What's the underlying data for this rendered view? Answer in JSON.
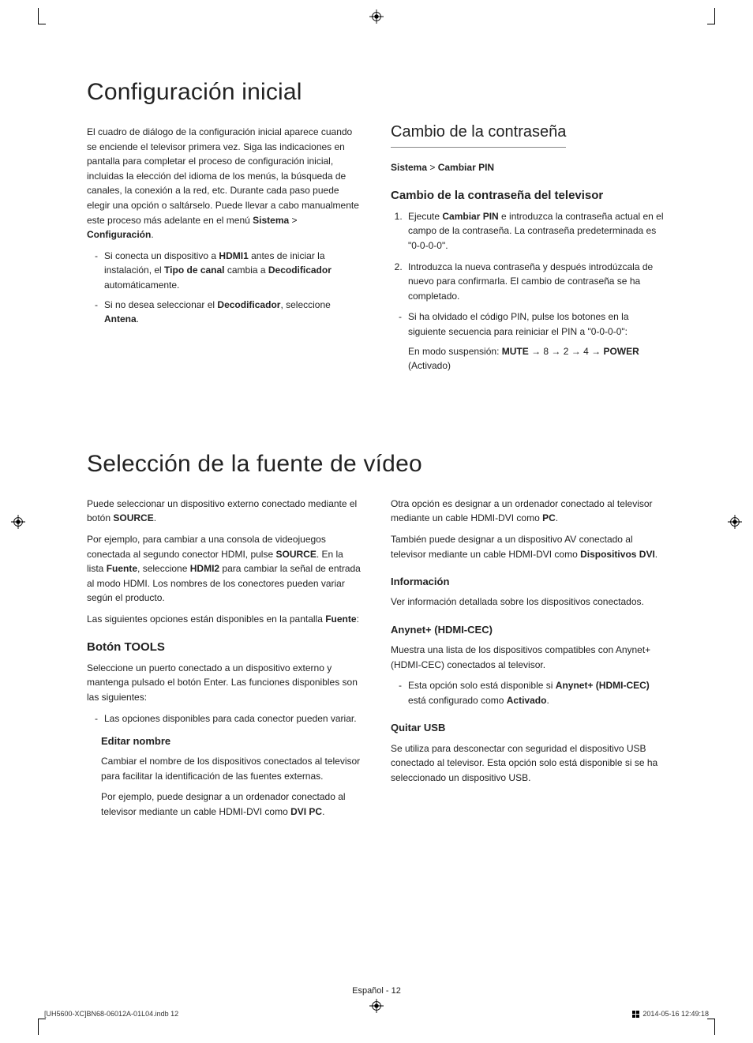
{
  "section1": {
    "title": "Configuración inicial",
    "left": {
      "intro": "El cuadro de diálogo de la configuración inicial aparece cuando se enciende el televisor primera vez. Siga las indicaciones en pantalla para completar el proceso de configuración inicial, incluidas la elección del idioma de los menús, la búsqueda de canales, la conexión a la red, etc. Durante cada paso puede elegir una opción o saltárselo. Puede llevar a cabo manualmente este proceso más adelante en el menú ",
      "intro_b1": "Sistema",
      "intro_sep": " > ",
      "intro_b2": "Configuración",
      "intro_end": ".",
      "li1_a": "Si conecta un dispositivo a ",
      "li1_b1": "HDMI1",
      "li1_b": " antes de iniciar la instalación, el ",
      "li1_b2": "Tipo de canal",
      "li1_c": " cambia a ",
      "li1_b3": "Decodificador",
      "li1_d": " automáticamente.",
      "li2_a": "Si no desea seleccionar el ",
      "li2_b1": "Decodificador",
      "li2_b": ", seleccione ",
      "li2_b2": "Antena",
      "li2_c": "."
    },
    "right": {
      "h2": "Cambio de la contraseña",
      "bc_b1": "Sistema",
      "bc_sep": " > ",
      "bc_b2": "Cambiar PIN",
      "h3": "Cambio de la contraseña del televisor",
      "ol1_a": "Ejecute ",
      "ol1_b": "Cambiar PIN",
      "ol1_c": " e introduzca la contraseña actual en el campo de la contraseña. La contraseña predeterminada es \"0-0-0-0\".",
      "ol2": "Introduzca la nueva contraseña y después introdúzcala de nuevo para confirmarla. El cambio de contraseña se ha completado.",
      "note1": "Si ha olvidado el código PIN, pulse los botones en la siguiente secuencia para reiniciar el PIN a \"0-0-0-0\":",
      "note2_a": "En modo suspensión: ",
      "note2_b1": "MUTE",
      "note2_m": " → 8 → 2 → 4 → ",
      "note2_b2": "POWER",
      "note2_c": " (Activado)"
    }
  },
  "section2": {
    "title": "Selección de la fuente de vídeo",
    "left": {
      "p1_a": "Puede seleccionar un dispositivo externo conectado mediante el botón ",
      "p1_b": "SOURCE",
      "p1_c": ".",
      "p2_a": "Por ejemplo, para cambiar a una consola de videojuegos conectada al segundo conector HDMI, pulse ",
      "p2_b1": "SOURCE",
      "p2_b": ". En la lista ",
      "p2_b2": "Fuente",
      "p2_c": ", seleccione ",
      "p2_b3": "HDMI2",
      "p2_d": " para cambiar la señal de entrada al modo HDMI. Los nombres de los conectores pueden variar según el producto.",
      "p3_a": "Las siguientes opciones están disponibles en la pantalla ",
      "p3_b": "Fuente",
      "p3_c": ":",
      "h3": "Botón TOOLS",
      "p4": "Seleccione un puerto conectado a un dispositivo externo y mantenga pulsado el botón Enter. Las funciones disponibles son las siguientes:",
      "li1": "Las opciones disponibles para cada conector pueden variar.",
      "h4": "Editar nombre",
      "p5": "Cambiar el nombre de los dispositivos conectados al televisor para facilitar la identificación de las fuentes externas.",
      "p6_a": "Por ejemplo, puede designar a un ordenador conectado al televisor mediante un cable HDMI-DVI como ",
      "p6_b": "DVI PC",
      "p6_c": "."
    },
    "right": {
      "p1_a": "Otra opción es designar a un ordenador conectado al televisor mediante un cable HDMI-DVI como ",
      "p1_b": "PC",
      "p1_c": ".",
      "p2_a": "También puede designar a un dispositivo AV conectado al televisor mediante un cable HDMI-DVI como ",
      "p2_b": "Dispositivos DVI",
      "p2_c": ".",
      "h4a": "Información",
      "p3": "Ver información detallada sobre los dispositivos conectados.",
      "h4b": "Anynet+ (HDMI-CEC)",
      "p4": "Muestra una lista de los dispositivos compatibles con Anynet+ (HDMI-CEC) conectados al televisor.",
      "li1_a": "Esta opción solo está disponible si ",
      "li1_b1": "Anynet+ (HDMI-CEC)",
      "li1_b": " está configurado como ",
      "li1_b2": "Activado",
      "li1_c": ".",
      "h4c": "Quitar USB",
      "p5": "Se utiliza para desconectar con seguridad el dispositivo USB conectado al televisor. Esta opción solo está disponible si se ha seleccionado un dispositivo USB."
    }
  },
  "footer": {
    "page": "Español - 12",
    "file": "[UH5600-XC]BN68-06012A-01L04.indb   12",
    "time": "2014-05-16   12:49:18"
  }
}
